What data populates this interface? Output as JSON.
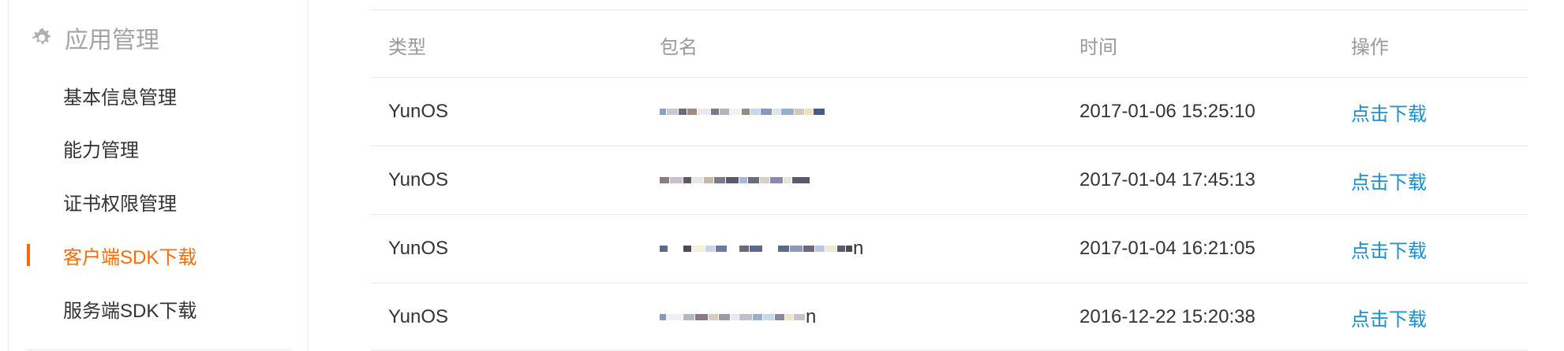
{
  "sidebar": {
    "section_title": "应用管理",
    "section_icon": "gear-icon",
    "items": [
      {
        "label": "基本信息管理",
        "active": false
      },
      {
        "label": "能力管理",
        "active": false
      },
      {
        "label": "证书权限管理",
        "active": false
      },
      {
        "label": "客户端SDK下载",
        "active": true
      },
      {
        "label": "服务端SDK下载",
        "active": false
      }
    ]
  },
  "table": {
    "headers": {
      "type": "类型",
      "package": "包名",
      "time": "时间",
      "action": "操作"
    },
    "rows": [
      {
        "type": "YunOS",
        "package": "",
        "time": "2017-01-06 15:25:10",
        "action": "点击下载"
      },
      {
        "type": "YunOS",
        "package": "",
        "time": "2017-01-04 17:45:13",
        "action": "点击下载"
      },
      {
        "type": "YunOS",
        "package": "n",
        "time": "2017-01-04 16:21:05",
        "action": "点击下载"
      },
      {
        "type": "YunOS",
        "package": "n",
        "time": "2016-12-22 15:20:38",
        "action": "点击下载"
      }
    ]
  },
  "colors": {
    "accent_active": "#ff6a00",
    "link": "#1890d5",
    "header_text": "#999999",
    "body_text": "#333333"
  }
}
